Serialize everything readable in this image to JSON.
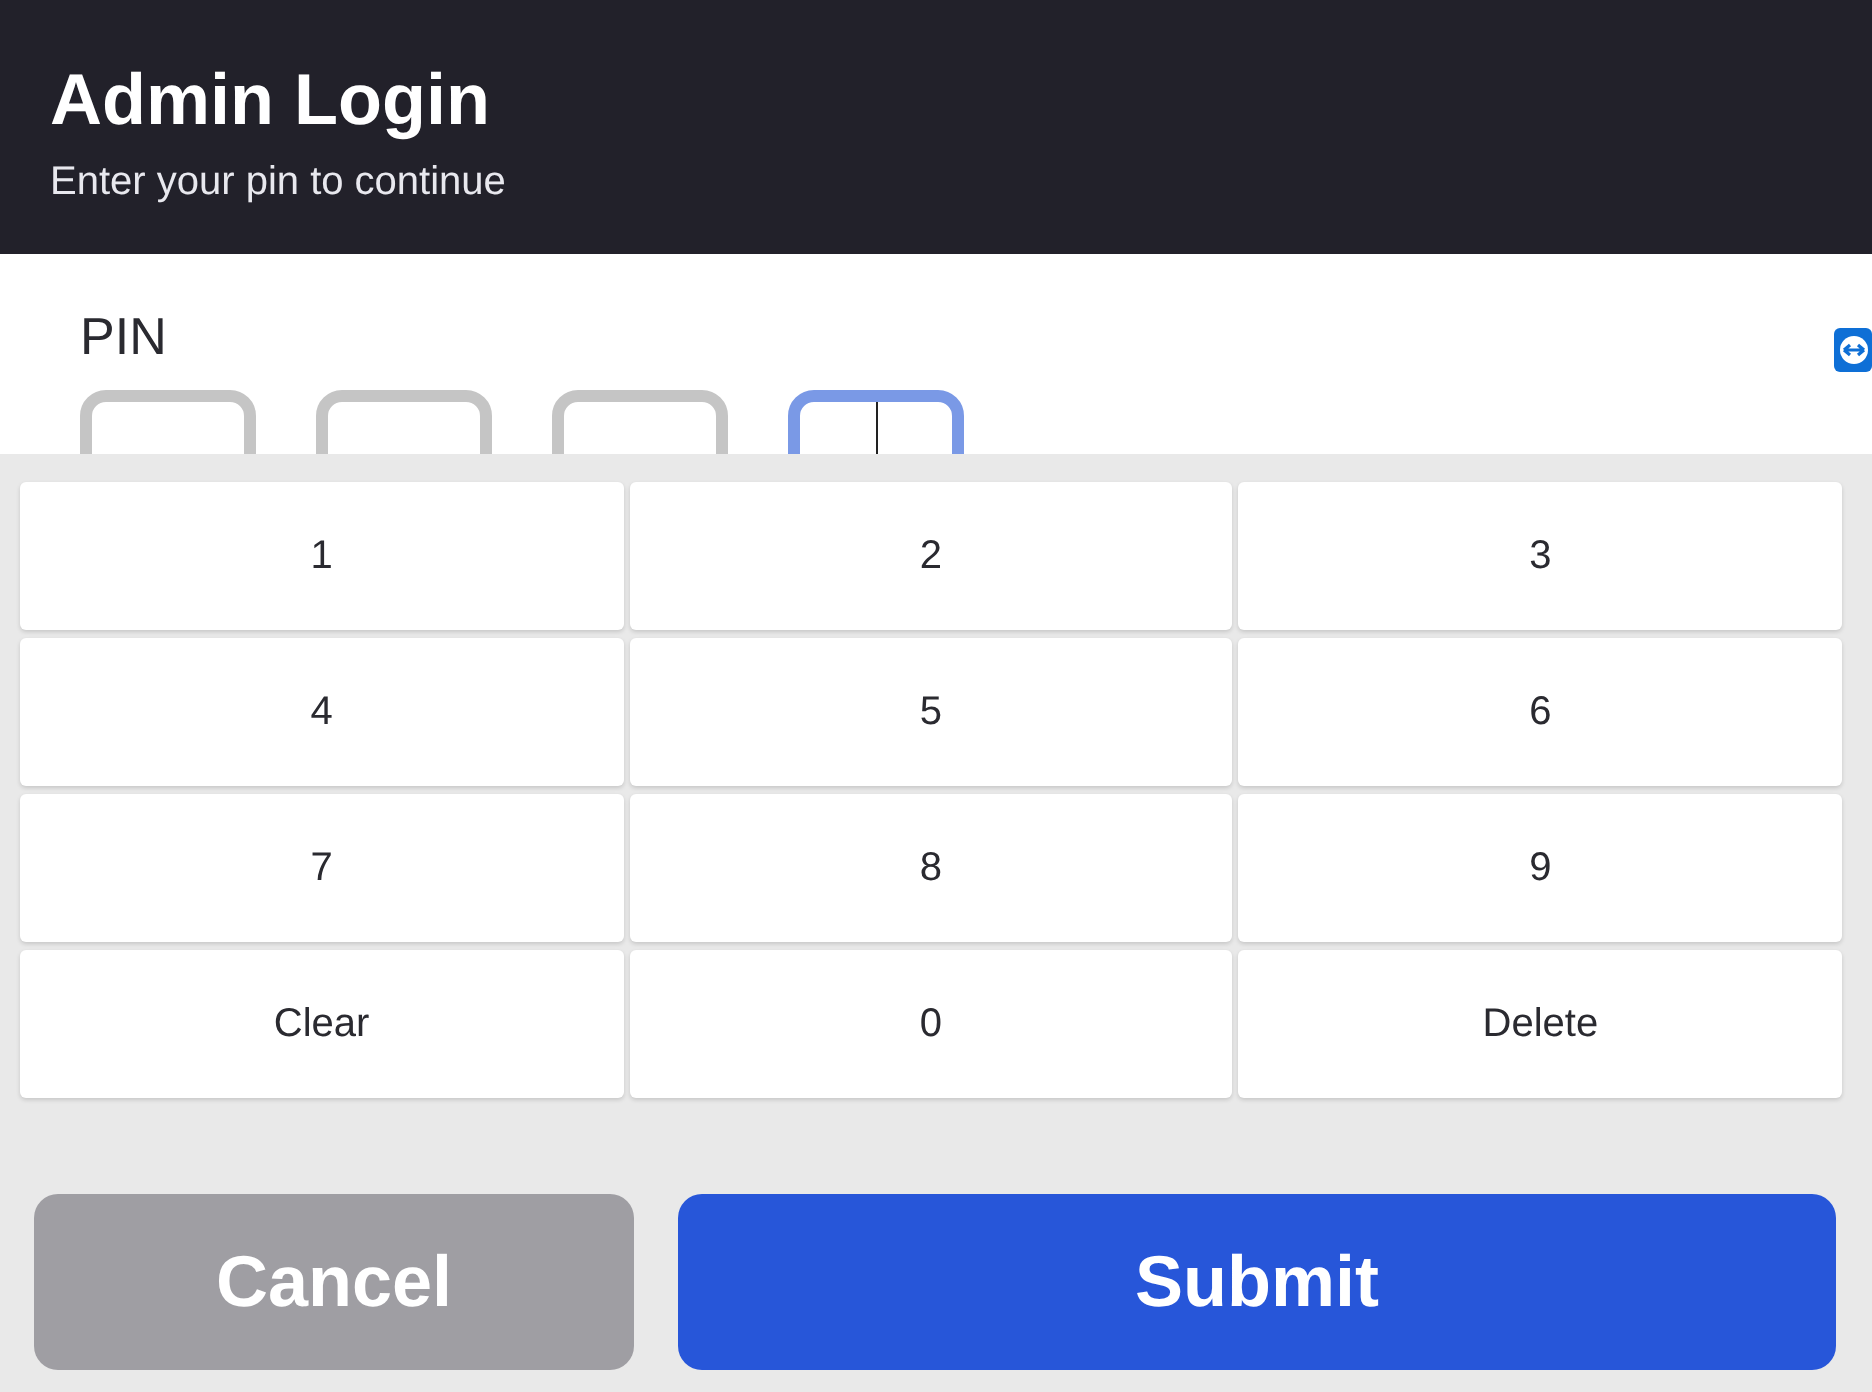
{
  "header": {
    "title": "Admin Login",
    "subtitle": "Enter your pin to continue"
  },
  "pin": {
    "label": "PIN",
    "boxes": [
      {
        "selected": false
      },
      {
        "selected": false
      },
      {
        "selected": false
      },
      {
        "selected": true
      }
    ]
  },
  "keypad": [
    {
      "label": "1"
    },
    {
      "label": "2"
    },
    {
      "label": "3"
    },
    {
      "label": "4"
    },
    {
      "label": "5"
    },
    {
      "label": "6"
    },
    {
      "label": "7"
    },
    {
      "label": "8"
    },
    {
      "label": "9"
    },
    {
      "label": "Clear"
    },
    {
      "label": "0"
    },
    {
      "label": "Delete"
    }
  ],
  "buttons": [
    {
      "label": "Cancel",
      "kind": "secondary"
    },
    {
      "label": "Submit",
      "kind": "primary"
    }
  ]
}
